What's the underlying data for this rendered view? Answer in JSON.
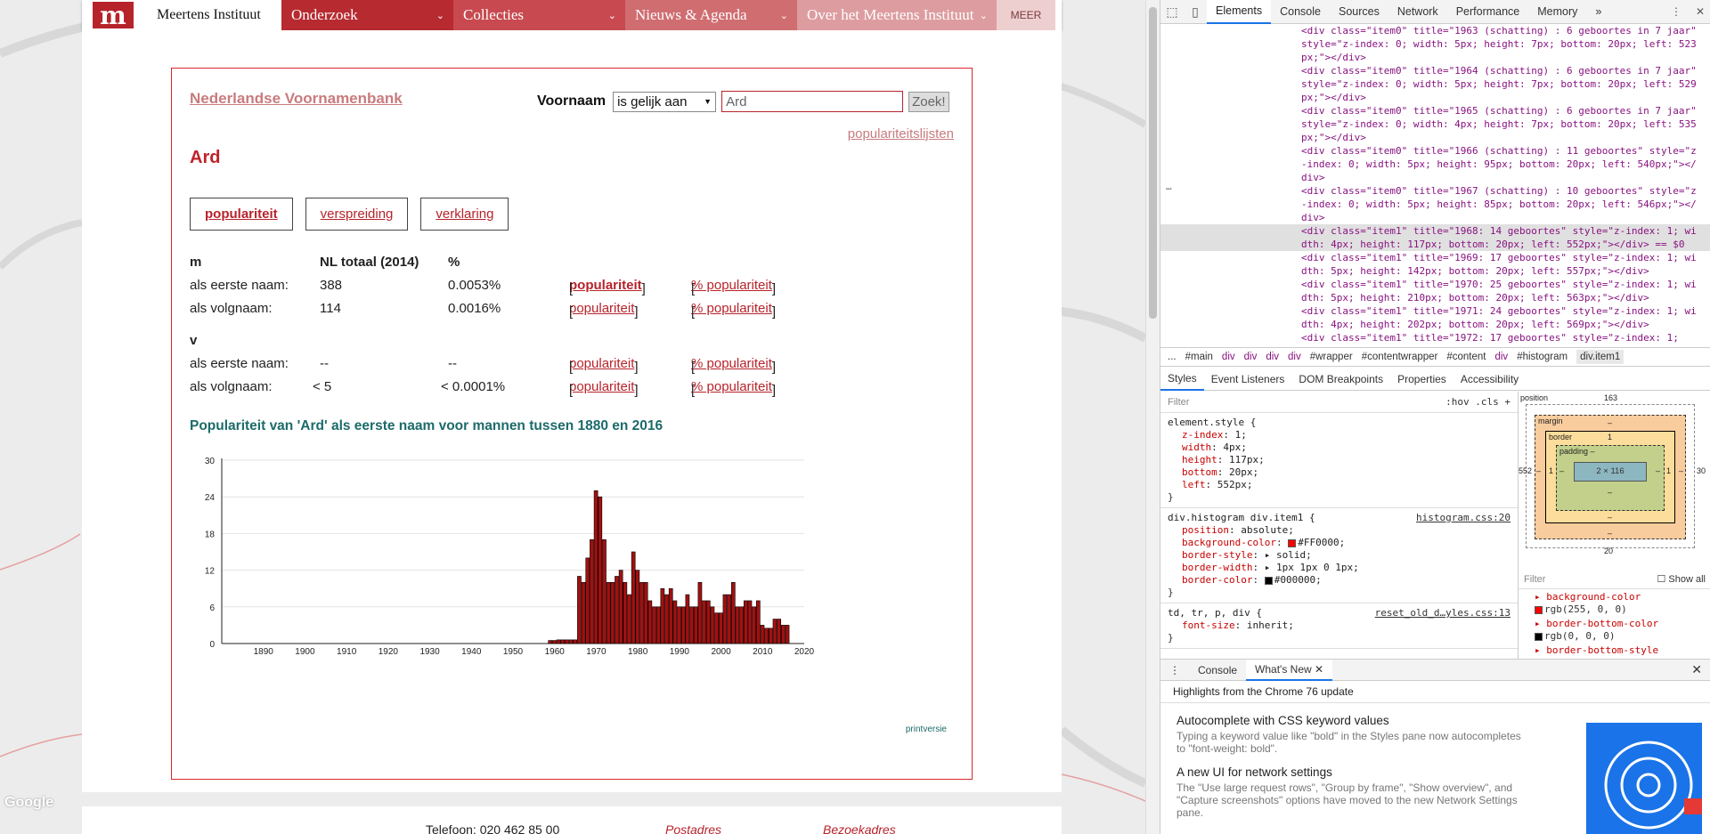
{
  "site": {
    "logo": "m",
    "brand": "Meertens Instituut",
    "nav": [
      {
        "label": "Onderzoek"
      },
      {
        "label": "Collecties"
      },
      {
        "label": "Nieuws & Agenda"
      },
      {
        "label": "Over het Meertens Instituut"
      }
    ],
    "more_label": "MEER"
  },
  "nvb": {
    "title": "Nederlandse Voornamenbank",
    "search": {
      "label": "Voornaam",
      "mode": "is gelijk aan",
      "value": "Ard",
      "button": "Zoek!"
    },
    "popularity_lists": "populariteitslijsten",
    "name": "Ard",
    "tabs": [
      "populariteit",
      "verspreiding",
      "verklaring"
    ],
    "stats": {
      "m": {
        "heading": "m",
        "col_total": "NL totaal (2014)",
        "col_pct": "%",
        "rows": [
          {
            "label": "als eerste naam:",
            "total": "388",
            "pct": "0.0053%",
            "link1": "populariteit",
            "link2": "% populariteit"
          },
          {
            "label": "als volgnaam:",
            "total": "114",
            "pct": "0.0016%",
            "link1": "populariteit",
            "link2": "% populariteit"
          }
        ]
      },
      "v": {
        "heading": "v",
        "rows": [
          {
            "label": "als eerste naam:",
            "total": "--",
            "pct": "--",
            "link1": "populariteit",
            "link2": "% populariteit"
          },
          {
            "label": "als volgnaam:",
            "total": "< 5",
            "pct": "< 0.0001%",
            "link1": "populariteit",
            "link2": "% populariteit"
          }
        ]
      }
    },
    "chart_title": "Populariteit van 'Ard' als eerste naam voor mannen tussen 1880 en 2016",
    "print_label": "printversie"
  },
  "chart_data": {
    "type": "bar",
    "title": "Populariteit van 'Ard' als eerste naam voor mannen tussen 1880 en 2016",
    "xlabel": "",
    "ylabel": "",
    "xlim": [
      1880,
      2020
    ],
    "ylim": [
      0,
      30
    ],
    "yticks": [
      0,
      6,
      12,
      18,
      24,
      30
    ],
    "xticks": [
      1890,
      1900,
      1910,
      1920,
      1930,
      1940,
      1950,
      1960,
      1970,
      1980,
      1990,
      2000,
      2010,
      2020
    ],
    "bar_color": "#a31010",
    "x": [
      1959,
      1960,
      1961,
      1962,
      1963,
      1964,
      1965,
      1966,
      1967,
      1968,
      1969,
      1970,
      1971,
      1972,
      1973,
      1974,
      1975,
      1976,
      1977,
      1978,
      1979,
      1980,
      1981,
      1982,
      1983,
      1984,
      1985,
      1986,
      1987,
      1988,
      1989,
      1990,
      1991,
      1992,
      1993,
      1994,
      1995,
      1996,
      1997,
      1998,
      1999,
      2000,
      2001,
      2002,
      2003,
      2004,
      2005,
      2006,
      2007,
      2008,
      2009,
      2010,
      2011,
      2012,
      2013,
      2014,
      2015,
      2016
    ],
    "values": [
      0.5,
      0.5,
      0.6,
      0.6,
      0.6,
      0.6,
      0.6,
      11,
      10,
      14,
      17,
      25,
      24,
      17,
      10,
      10,
      11,
      12,
      10,
      8,
      15,
      12,
      10,
      10,
      7,
      6,
      6,
      9,
      8,
      9,
      7,
      6,
      6,
      8,
      6,
      6,
      10,
      7,
      7,
      6,
      5,
      5,
      8,
      8,
      10,
      6,
      6,
      7,
      7,
      6,
      7,
      3,
      2.5,
      2.5,
      4,
      4,
      3,
      3
    ]
  },
  "footer": {
    "phone": "Telefoon: 020 462 85 00",
    "postal": "Postadres",
    "visit": "Bezoekadres",
    "google": "Google"
  },
  "devtools": {
    "tabs": [
      "Elements",
      "Console",
      "Sources",
      "Network",
      "Performance",
      "Memory"
    ],
    "active_tab": "Elements",
    "dom_lines": [
      {
        "text": "<div class=\"item0\" title=\"1963 (schatting) : 6 geboortes in 7 jaar\" style=\"z-index: 0; width: 5px; height: 7px; bottom: 20px; left: 523px;\"></div>"
      },
      {
        "text": "<div class=\"item0\" title=\"1964 (schatting) : 6 geboortes in 7 jaar\" style=\"z-index: 0; width: 5px; height: 7px; bottom: 20px; left: 529px;\"></div>"
      },
      {
        "text": "<div class=\"item0\" title=\"1965 (schatting) : 6 geboortes in 7 jaar\" style=\"z-index: 0; width: 4px; height: 7px; bottom: 20px; left: 535px;\"></div>"
      },
      {
        "text": "<div class=\"item0\" title=\"1966 (schatting) : 11 geboortes\" style=\"z-index: 0; width: 5px; height: 95px; bottom: 20px; left: 540px;\"></div>"
      },
      {
        "text": "<div class=\"item0\" title=\"1967 (schatting) : 10 geboortes\" style=\"z-index: 0; width: 5px; height: 85px; bottom: 20px; left: 546px;\"></div>"
      },
      {
        "text": "<div class=\"item1\" title=\"1968: 14 geboortes\" style=\"z-index: 1; width: 4px; height: 117px; bottom: 20px; left: 552px;\"></div> == $0"
      },
      {
        "text": "<div class=\"item1\" title=\"1969: 17 geboortes\" style=\"z-index: 1; width: 5px; height: 142px; bottom: 20px; left: 557px;\"></div>"
      },
      {
        "text": "<div class=\"item1\" title=\"1970: 25 geboortes\" style=\"z-index: 1; width: 5px; height: 210px; bottom: 20px; left: 563px;\"></div>"
      },
      {
        "text": "<div class=\"item1\" title=\"1971: 24 geboortes\" style=\"z-index: 1; width: 4px; height: 202px; bottom: 20px; left: 569px;\"></div>"
      },
      {
        "text": "<div class=\"item1\" title=\"1972: 17 geboortes\" style=\"z-index: 1;"
      }
    ],
    "breadcrumbs": [
      "...",
      "#main",
      "div",
      "div",
      "div",
      "div",
      "#wrapper",
      "#contentwrapper",
      "#content",
      "div",
      "#histogram",
      "div.item1"
    ],
    "style_tabs": [
      "Styles",
      "Event Listeners",
      "DOM Breakpoints",
      "Properties",
      "Accessibility"
    ],
    "filter_placeholder": "Filter",
    "filter_tools": ":hov  .cls  +",
    "element_style": {
      "selector": "element.style {",
      "decls": [
        {
          "p": "z-index",
          "v": "1;"
        },
        {
          "p": "width",
          "v": "4px;"
        },
        {
          "p": "height",
          "v": "117px;"
        },
        {
          "p": "bottom",
          "v": "20px;"
        },
        {
          "p": "left",
          "v": "552px;"
        }
      ]
    },
    "rule2": {
      "selector": "div.histogram div.item1 {",
      "source": "histogram.css:20",
      "decls": [
        {
          "p": "position",
          "v": "absolute;"
        },
        {
          "p": "background-color",
          "v": "#FF0000;"
        },
        {
          "p": "border-style",
          "v": "▸ solid;"
        },
        {
          "p": "border-width",
          "v": "▸ 1px 1px 0 1px;"
        },
        {
          "p": "border-color",
          "v": "#000000;"
        }
      ]
    },
    "rule3": {
      "selector": "td, tr, p, div {",
      "source": "reset_old_d…yles.css:13",
      "decls": [
        {
          "p": "font-size",
          "v": "inherit;"
        }
      ]
    },
    "boxmodel": {
      "position_label": "position",
      "position_top": "163",
      "margin_label": "margin",
      "margin_dash": "–",
      "border_label": "border",
      "border_val": "1",
      "padding_label": "padding –",
      "content": "2 × 116",
      "left_pos": "552",
      "right_pos": "30",
      "side_val": "1",
      "bottom_pos": "20"
    },
    "computed": {
      "filter": "Filter",
      "show_all": "Show all",
      "props": [
        {
          "p": "background-color",
          "v": "rgb(255, 0, 0)"
        },
        {
          "p": "border-bottom-color",
          "v": "rgb(0, 0, 0)"
        },
        {
          "p": "border-bottom-style",
          "v": ""
        }
      ]
    },
    "drawer_tabs": [
      "Console",
      "What's New"
    ],
    "whatsnew": {
      "highlight": "Highlights from the Chrome 76 update",
      "items": [
        {
          "h": "Autocomplete with CSS keyword values",
          "p": "Typing a keyword value like \"bold\" in the Styles pane now autocompletes to \"font-weight: bold\"."
        },
        {
          "h": "A new UI for network settings",
          "p": "The \"Use large request rows\", \"Group by frame\", \"Show overview\", and \"Capture screenshots\" options have moved to the new Network Settings pane."
        }
      ]
    }
  }
}
